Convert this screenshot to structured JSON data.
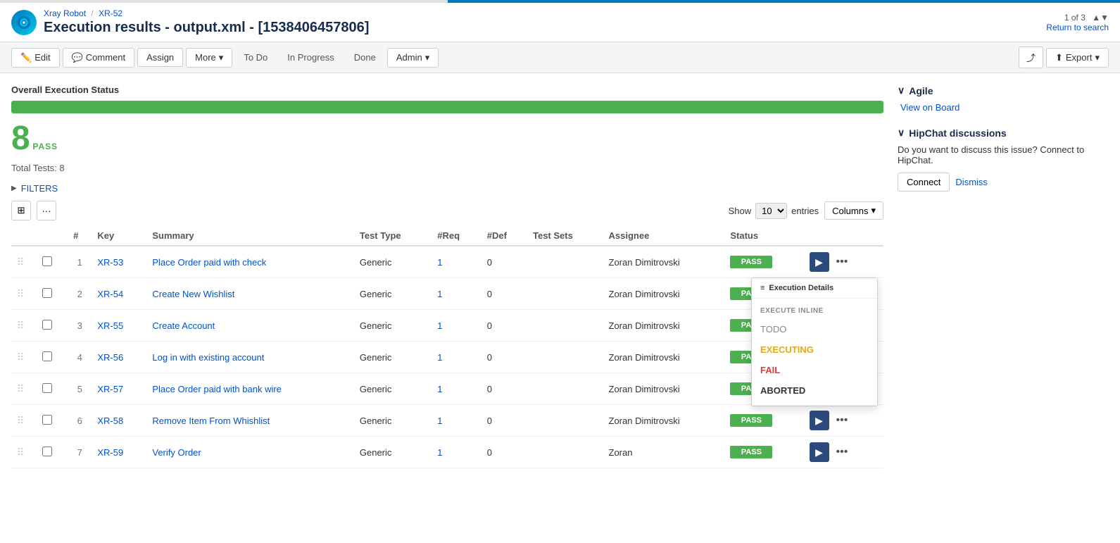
{
  "app": {
    "logo_alt": "Xray Robot logo"
  },
  "breadcrumb": {
    "project": "Xray Robot",
    "separator": "/",
    "issue": "XR-52"
  },
  "page_title": "Execution results - output.xml - [1538406457806]",
  "pagination": {
    "current": "1 of 3",
    "return_label": "Return to search"
  },
  "toolbar": {
    "edit_label": "Edit",
    "comment_label": "Comment",
    "assign_label": "Assign",
    "more_label": "More",
    "todo_label": "To Do",
    "in_progress_label": "In Progress",
    "done_label": "Done",
    "admin_label": "Admin",
    "export_label": "Export"
  },
  "execution_status": {
    "section_label": "Overall Execution Status",
    "pass_count": "8",
    "pass_text": "PASS",
    "progress_pct": 100,
    "total_tests_label": "Total Tests: 8"
  },
  "filters": {
    "label": "FILTERS"
  },
  "table_controls": {
    "show_label": "Show",
    "show_value": "10",
    "entries_label": "entries",
    "columns_label": "Columns"
  },
  "table": {
    "columns": [
      "Key",
      "Summary",
      "Test Type",
      "#Req",
      "#Def",
      "Test Sets",
      "Assignee",
      "Status"
    ],
    "rows": [
      {
        "num": "1",
        "key": "XR-53",
        "summary": "Place Order paid with check",
        "test_type": "Generic",
        "req": "1",
        "def": "0",
        "test_sets": "",
        "assignee": "Zoran Dimitrovski",
        "status": "PASS",
        "show_dropdown": true
      },
      {
        "num": "2",
        "key": "XR-54",
        "summary": "Create New Wishlist",
        "test_type": "Generic",
        "req": "1",
        "def": "0",
        "test_sets": "",
        "assignee": "Zoran Dimitrovski",
        "status": "PASS",
        "show_dropdown": false
      },
      {
        "num": "3",
        "key": "XR-55",
        "summary": "Create Account",
        "test_type": "Generic",
        "req": "1",
        "def": "0",
        "test_sets": "",
        "assignee": "Zoran Dimitrovski",
        "status": "PASS",
        "show_dropdown": false
      },
      {
        "num": "4",
        "key": "XR-56",
        "summary": "Log in with existing account",
        "test_type": "Generic",
        "req": "1",
        "def": "0",
        "test_sets": "",
        "assignee": "Zoran Dimitrovski",
        "status": "PASS",
        "show_dropdown": false
      },
      {
        "num": "5",
        "key": "XR-57",
        "summary": "Place Order paid with bank wire",
        "test_type": "Generic",
        "req": "1",
        "def": "0",
        "test_sets": "",
        "assignee": "Zoran Dimitrovski",
        "status": "PASS",
        "show_dropdown": false
      },
      {
        "num": "6",
        "key": "XR-58",
        "summary": "Remove Item From Whishlist",
        "test_type": "Generic",
        "req": "1",
        "def": "0",
        "test_sets": "",
        "assignee": "Zoran Dimitrovski",
        "status": "PASS",
        "show_dropdown": false
      },
      {
        "num": "7",
        "key": "XR-59",
        "summary": "Verify Order",
        "test_type": "Generic",
        "req": "1",
        "def": "0",
        "test_sets": "",
        "assignee": "Zoran",
        "status": "PASS",
        "show_dropdown": false
      }
    ]
  },
  "dropdown_menu": {
    "header": "Execution Details",
    "execute_inline_label": "EXECUTE INLINE",
    "todo": "TODO",
    "executing": "EXECUTING",
    "fail": "FAIL",
    "aborted": "ABORTED"
  },
  "sidebar": {
    "agile_title": "Agile",
    "view_on_board": "View on Board",
    "hipchat_title": "HipChat discussions",
    "hipchat_text": "Do you want to discuss this issue? Connect to HipChat.",
    "connect_label": "Connect",
    "dismiss_label": "Dismiss"
  }
}
